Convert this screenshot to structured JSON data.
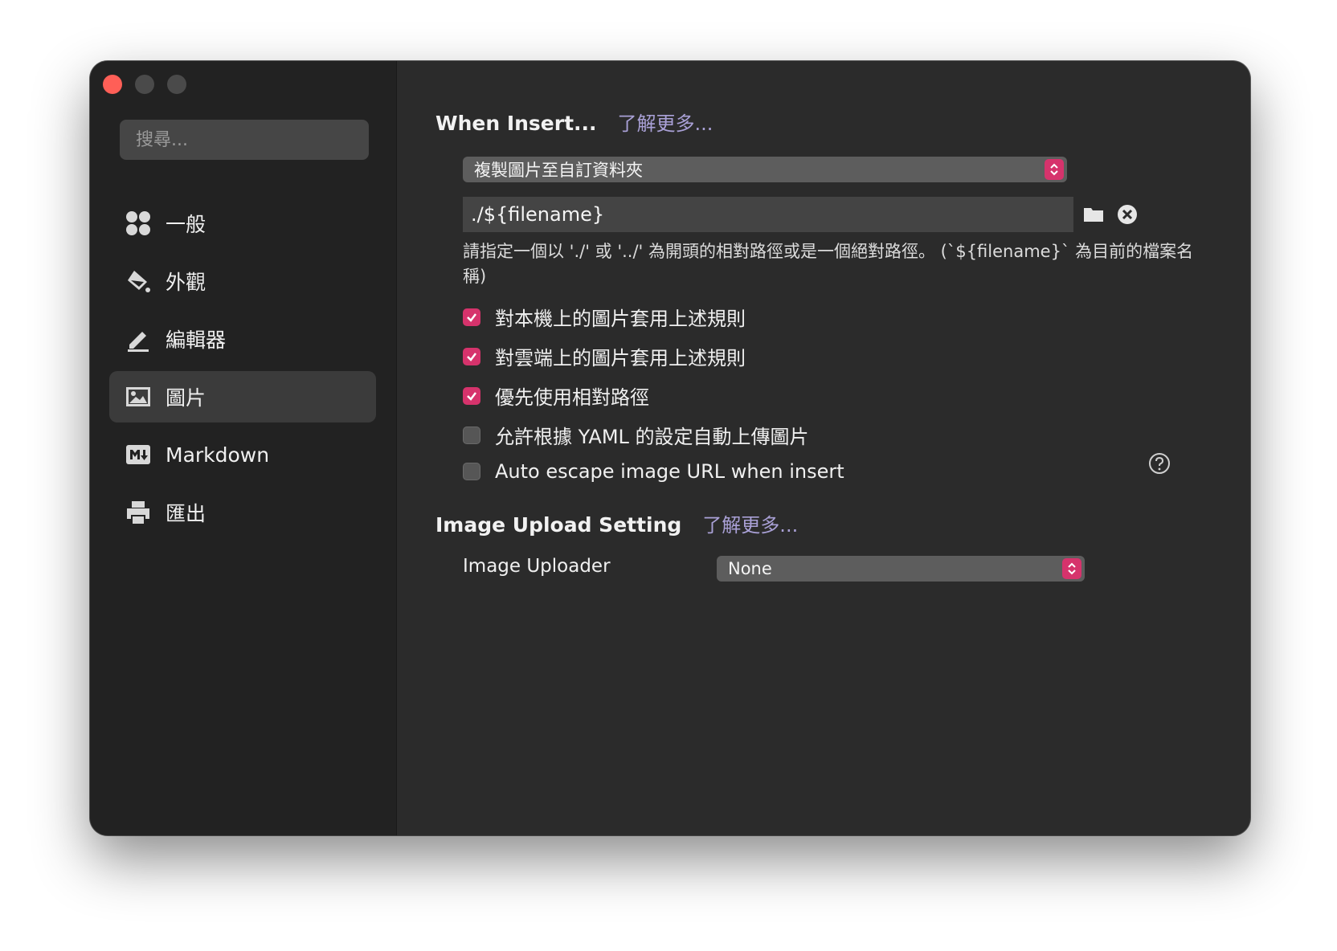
{
  "sidebar": {
    "search_placeholder": "搜尋...",
    "items": [
      {
        "label": "一般",
        "icon": "grid-icon"
      },
      {
        "label": "外觀",
        "icon": "paint-bucket-icon"
      },
      {
        "label": "編輯器",
        "icon": "pencil-icon"
      },
      {
        "label": "圖片",
        "icon": "image-icon",
        "active": true
      },
      {
        "label": "Markdown",
        "icon": "markdown-icon"
      },
      {
        "label": "匯出",
        "icon": "printer-icon"
      }
    ]
  },
  "insert_section": {
    "title": "When Insert...",
    "learn_more": "了解更多...",
    "action_select": "複製圖片至自訂資料夾",
    "path_value": "./${filename}",
    "help_text": " 請指定一個以 './' 或 '../' 為開頭的相對路徑或是一個絕對路徑。 (`${filename}` 為目前的檔案名稱)",
    "options": [
      {
        "label": "對本機上的圖片套用上述規則",
        "checked": true
      },
      {
        "label": "對雲端上的圖片套用上述規則",
        "checked": true
      },
      {
        "label": "優先使用相對路徑",
        "checked": true
      },
      {
        "label": "允許根據 YAML 的設定自動上傳圖片",
        "checked": false
      },
      {
        "label": "Auto escape image URL when insert",
        "checked": false
      }
    ]
  },
  "upload_section": {
    "title": "Image Upload Setting",
    "learn_more": "了解更多...",
    "uploader_label": "Image Uploader",
    "uploader_value": "None"
  },
  "colors": {
    "accent": "#d6336c",
    "link": "#a9a0d6",
    "close_button": "#ff5f57"
  }
}
